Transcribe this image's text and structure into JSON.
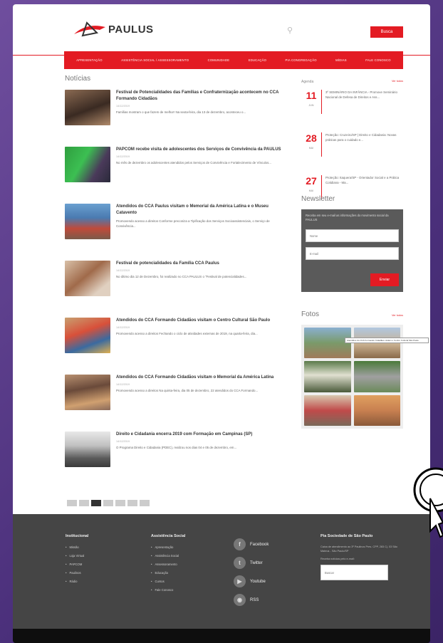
{
  "header": {
    "logo_text": "PAULUS",
    "top_button": "Busca"
  },
  "nav": {
    "items": [
      "APRESENTAÇÃO",
      "ASSISTÊNCIA SOCIAL / ASSESSORAMENTO",
      "COMUNIDADE",
      "EDUCAÇÃO",
      "PIA CONGREGAÇÃO",
      "MÍDIAS",
      "FALE CONOSCO"
    ]
  },
  "news": {
    "title": "Notícias",
    "items": [
      {
        "headline": "Festival de Potencialidades das Famílias e Confraternização acontecem no CCA Formando Cidadãos",
        "date": "14/12/2019",
        "summary": "Famílias mostram o que fazem de melhor! Na sexta-feira, dia 13 de dezembro, aconteceu o..."
      },
      {
        "headline": "PAPCOM recebe visita de adolescentes dos Serviços de Convivência da PAULUS",
        "date": "14/12/2019",
        "summary": "No mês de dezembro os adolescentes atendidos pelos Serviços de Convivência e Fortalecimento de Vínculos..."
      },
      {
        "headline": "Atendidos do CCA Paulus visitam o Memorial da América Latina e o Museu Catavento",
        "date": "",
        "summary": "Promovendo acesso a direitos Conforme preconiza a Tipificação dos Serviços Socioassistenciais, o Serviço de Convivência..."
      },
      {
        "headline": "Festival de potencialidades da Família CCA Paulus",
        "date": "14/12/2019",
        "summary": "No último dia 12 de Dezembro, foi realizado no CCA PAULUS o \"Festival de potencialidades..."
      },
      {
        "headline": "Atendidos do CCA Formando Cidadãos visitam o Centro Cultural São Paulo",
        "date": "14/12/2019",
        "summary": "Promovendo acesso a direitos Fechando o ciclo de atividades externas de 2019, na quarta-feira, dia..."
      },
      {
        "headline": "Atendidos do CCA Formando Cidadãos visitam o Memorial da América Latina",
        "date": "14/12/2019",
        "summary": "Promovendo acesso a direitos Na quinta-feira, dia 05 de dezembro, 22 atendidos do CCA Formando..."
      },
      {
        "headline": "Direito e Cidadania encerra 2019 com Formação em Campinas (SP)",
        "date": "14/12/2019",
        "summary": "O Programa Direito e Cidadania (PDEC), realizou nos dias 04 e 05 de dezembro, em..."
      }
    ]
  },
  "agenda": {
    "title": "Agenda",
    "see_all": "Ver todos",
    "items": [
      {
        "day": "11",
        "month": "JUN",
        "text": "3º SEMINÁRIO DA INFÂNCIA - Promove Seminário Nacional de Defesa de Direitos e Ass..."
      },
      {
        "day": "28",
        "month": "MAI",
        "text": "Proteção: Cruzeiro/SP | Direito e Cidadania: Novas práticas para o cuidado e..."
      },
      {
        "day": "27",
        "month": "MAI",
        "text": "Proteção: Itaquera/SP - Orientador Social e a Prática Cotidiana - Ma..."
      }
    ]
  },
  "newsletter": {
    "title": "Newsletter",
    "desc": "Receba em seu e-mail as informações do movimento social da PAULUS",
    "name_placeholder": "Nome",
    "email_placeholder": "E-mail",
    "button": "Enviar"
  },
  "fotos": {
    "title": "Fotos",
    "see_all": "Ver todos",
    "tooltip": "Atendidos do CCA Formando Cidadãos visitam o Centro Cultural São Paulo"
  },
  "footer": {
    "col1_title": "Institucional",
    "col1_items": [
      "Missão",
      "Loja Virtual",
      "PAPCOM",
      "Paulinos",
      "Rádio"
    ],
    "col2_title": "Assistência Social",
    "col2_items": [
      "Apresentação",
      "Assistência Social",
      "Assessoramento",
      "Educação",
      "Cursos",
      "Fale Conosco"
    ],
    "social": [
      {
        "icon": "f",
        "label": "Facebook"
      },
      {
        "icon": "t",
        "label": "Twitter"
      },
      {
        "icon": "▶",
        "label": "Youtube"
      },
      {
        "icon": "◉",
        "label": "RSS"
      }
    ],
    "pia_title": "Pia Sociedade de São Paulo",
    "pia_address": "Caixa de atendimento ao 3º Paulinos Pres. CPP, 283 Cj. 03 São Mateus - São Paulo/SP",
    "newsletter_label": "Receba notícias pelo e-mail:",
    "search_placeholder": "Buscar"
  },
  "colors": {
    "accent": "#e31b23",
    "footer_bg": "#454545"
  }
}
